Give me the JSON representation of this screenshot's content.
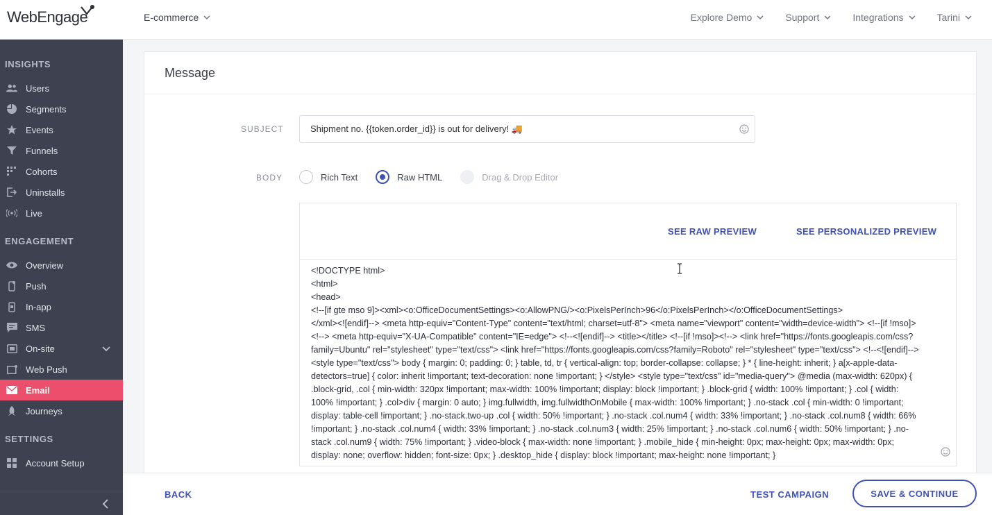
{
  "app": {
    "logo_text": "WebEngage",
    "workspace": "E-commerce"
  },
  "topnav": [
    {
      "label": "Explore Demo"
    },
    {
      "label": "Support"
    },
    {
      "label": "Integrations"
    },
    {
      "label": "Tarini"
    }
  ],
  "sidebar": {
    "insights_title": "INSIGHTS",
    "insights": [
      {
        "label": "Users",
        "icon": "users-icon"
      },
      {
        "label": "Segments",
        "icon": "pie-icon"
      },
      {
        "label": "Events",
        "icon": "star-icon"
      },
      {
        "label": "Funnels",
        "icon": "funnel-icon"
      },
      {
        "label": "Cohorts",
        "icon": "grid-icon"
      },
      {
        "label": "Uninstalls",
        "icon": "exit-icon"
      },
      {
        "label": "Live",
        "icon": "broadcast-icon"
      }
    ],
    "engagement_title": "ENGAGEMENT",
    "engagement": [
      {
        "label": "Overview",
        "icon": "eye-icon"
      },
      {
        "label": "Push",
        "icon": "phone-icon"
      },
      {
        "label": "In-app",
        "icon": "phone-square-icon"
      },
      {
        "label": "SMS",
        "icon": "chat-icon"
      },
      {
        "label": "On-site",
        "icon": "window-icon"
      },
      {
        "label": "Web Push",
        "icon": "browser-icon"
      },
      {
        "label": "Email",
        "icon": "envelope-icon"
      },
      {
        "label": "Journeys",
        "icon": "rocket-icon"
      }
    ],
    "settings_title": "SETTINGS",
    "settings": [
      {
        "label": "Account Setup",
        "icon": "apps-icon"
      }
    ]
  },
  "message": {
    "title": "Message",
    "subject_label": "SUBJECT",
    "subject_value": "Shipment no. {{token.order_id}} is out for delivery! 🚚",
    "body_label": "BODY",
    "body_options": [
      {
        "label": "Rich Text",
        "state": "unselected"
      },
      {
        "label": "Raw HTML",
        "state": "selected"
      },
      {
        "label": "Drag & Drop Editor",
        "state": "disabled"
      }
    ],
    "raw_preview": "SEE RAW PREVIEW",
    "personalized_preview": "SEE PERSONALIZED PREVIEW",
    "code": "<!DOCTYPE html>\n<html>\n<head>\n<!--[if gte mso 9]><xml><o:OfficeDocumentSettings><o:AllowPNG/><o:PixelsPerInch>96</o:PixelsPerInch></o:OfficeDocumentSettings>\n</xml><![endif]--> <meta http-equiv=\"Content-Type\" content=\"text/html; charset=utf-8\"> <meta name=\"viewport\" content=\"width=device-width\"> <!--[if !mso]><!--> <meta http-equiv=\"X-UA-Compatible\" content=\"IE=edge\"> <!--<![endif]--> <title></title> <!--[if !mso]><!--> <link href=\"https://fonts.googleapis.com/css?family=Ubuntu\" rel=\"stylesheet\" type=\"text/css\"> <link href=\"https://fonts.googleapis.com/css?family=Roboto\" rel=\"stylesheet\" type=\"text/css\"> <!--<![endif]--> <style type=\"text/css\"> body { margin: 0; padding: 0; } table, td, tr { vertical-align: top; border-collapse: collapse; } * { line-height: inherit; } a[x-apple-data-detectors=true] { color: inherit !important; text-decoration: none !important; } </style> <style type=\"text/css\" id=\"media-query\"> @media (max-width: 620px) { .block-grid, .col { min-width: 320px !important; max-width: 100% !important; display: block !important; } .block-grid { width: 100% !important; } .col { width: 100% !important; } .col>div { margin: 0 auto; } img.fullwidth, img.fullwidthOnMobile { max-width: 100% !important; } .no-stack .col { min-width: 0 !important; display: table-cell !important; } .no-stack.two-up .col { width: 50% !important; } .no-stack .col.num4 { width: 33% !important; } .no-stack .col.num8 { width: 66% !important; } .no-stack .col.num4 { width: 33% !important; } .no-stack .col.num3 { width: 25% !important; } .no-stack .col.num6 { width: 50% !important; } .no-stack .col.num9 { width: 75% !important; } .video-block { max-width: none !important; } .mobile_hide { min-height: 0px; max-height: 0px; max-width: 0px; display: none; overflow: hidden; font-size: 0px; } .desktop_hide { display: block !important; max-height: none !important; }"
  },
  "footer": {
    "back": "BACK",
    "test": "TEST CAMPAIGN",
    "save": "SAVE & CONTINUE"
  },
  "colors": {
    "accent": "#3f51b5",
    "active_nav": "#ec4f6c",
    "sidebar_bg": "#3d4150"
  }
}
